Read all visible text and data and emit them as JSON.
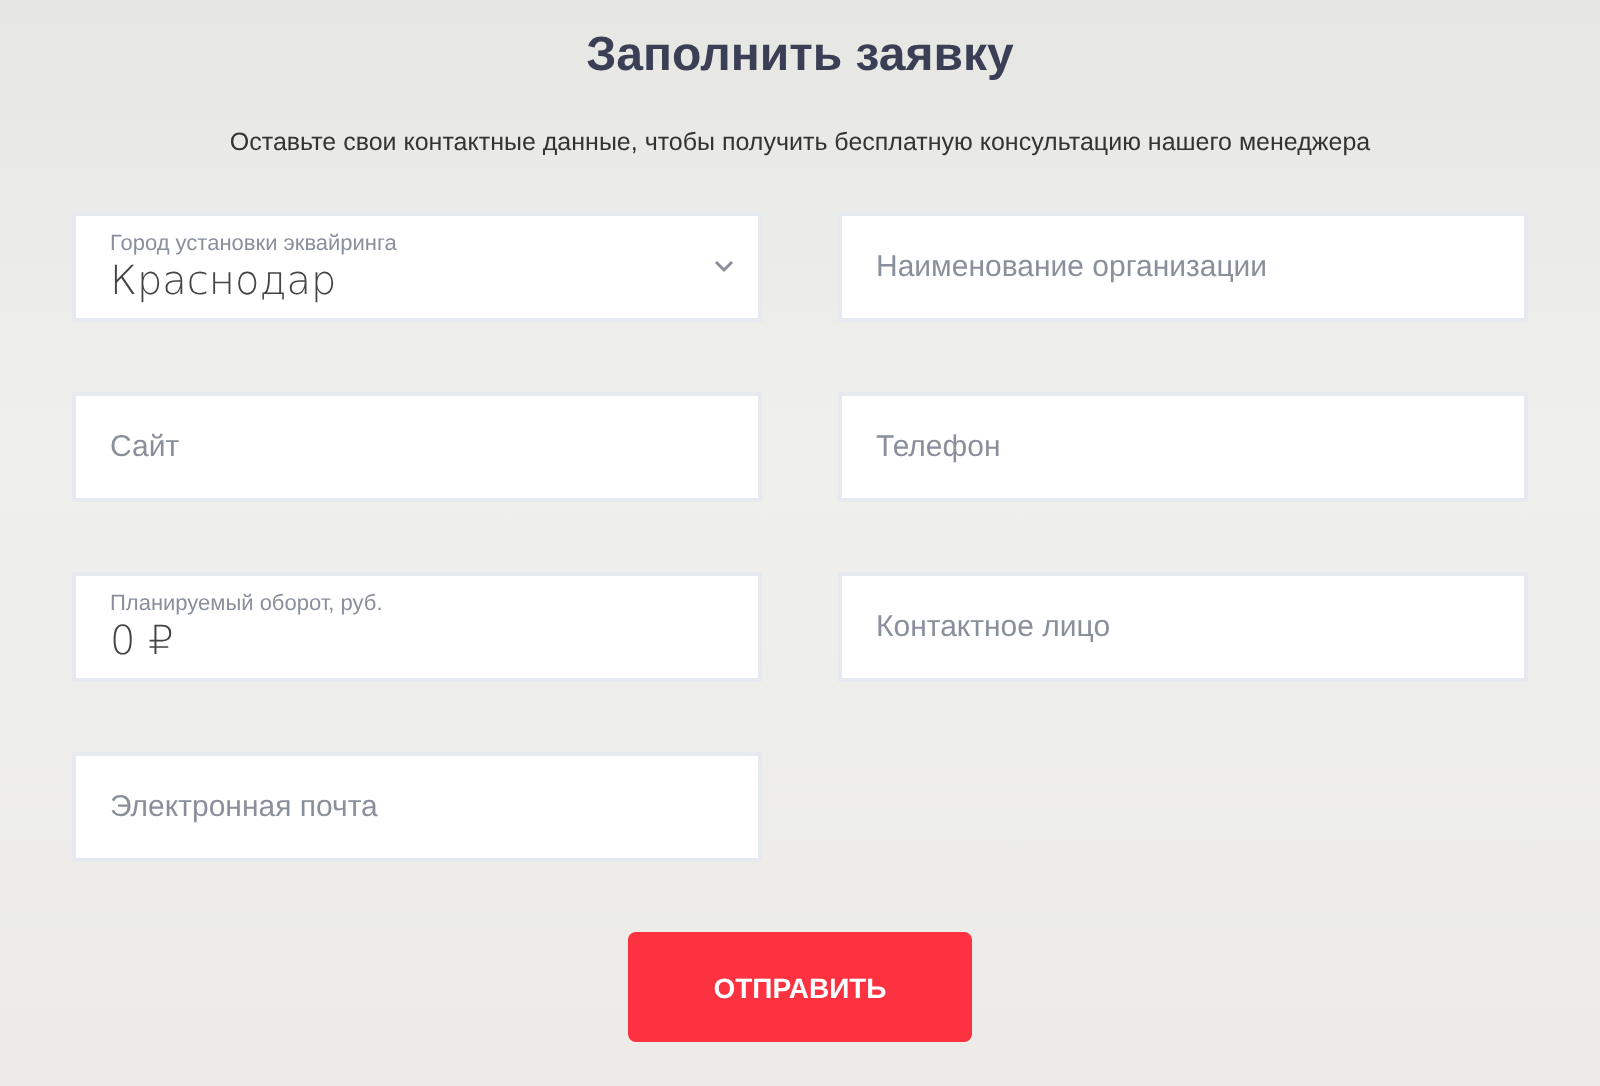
{
  "title": "Заполнить заявку",
  "subtitle": "Оставьте свои контактные данные, чтобы получить бесплатную консультацию нашего менеджера",
  "fields": [
    {
      "kind": "select",
      "label": "Город установки эквайринга",
      "value": "Краснодар"
    },
    {
      "kind": "input",
      "placeholder": "Наименование организации"
    },
    {
      "kind": "input",
      "placeholder": "Сайт"
    },
    {
      "kind": "input",
      "placeholder": "Телефон"
    },
    {
      "kind": "labeled",
      "label": "Планируемый оборот, руб.",
      "value": "0 ₽"
    },
    {
      "kind": "input",
      "placeholder": "Контактное лицо"
    },
    {
      "kind": "input",
      "placeholder": "Электронная почта"
    }
  ],
  "submit": "ОТПРАВИТЬ"
}
